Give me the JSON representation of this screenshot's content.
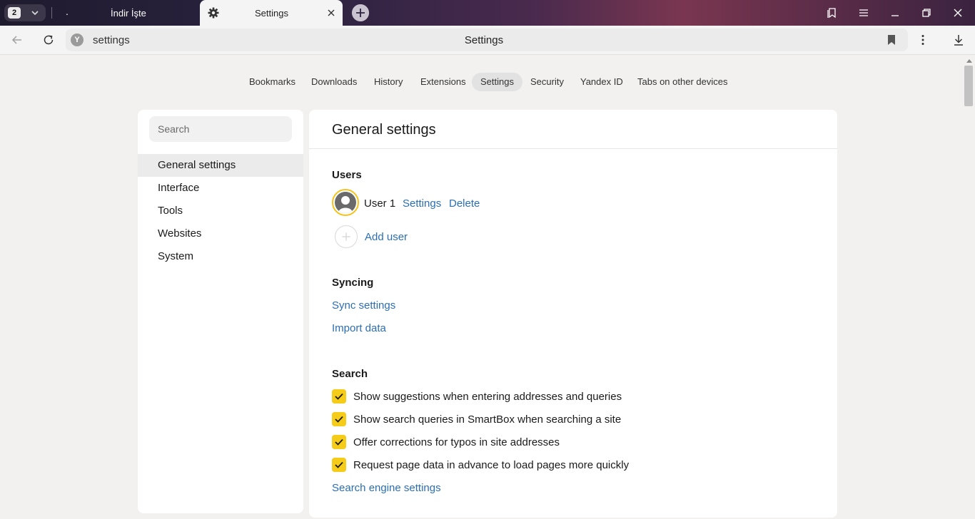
{
  "titlebar": {
    "tab_count": "2",
    "tabs": [
      {
        "label": "İndir İşte",
        "favicon": "."
      },
      {
        "label": "Settings",
        "icon": "gear-icon"
      }
    ]
  },
  "addressbar": {
    "url": "settings",
    "page_title": "Settings"
  },
  "topnav": {
    "items": [
      "Bookmarks",
      "Downloads",
      "History",
      "Extensions",
      "Settings",
      "Security",
      "Yandex ID",
      "Tabs on other devices"
    ],
    "active": "Settings"
  },
  "sidebar": {
    "search_placeholder": "Search",
    "items": [
      "General settings",
      "Interface",
      "Tools",
      "Websites",
      "System"
    ],
    "active": "General settings"
  },
  "main": {
    "title": "General settings",
    "users": {
      "heading": "Users",
      "user_name": "User 1",
      "settings_link": "Settings",
      "delete_link": "Delete",
      "add_user": "Add user"
    },
    "syncing": {
      "heading": "Syncing",
      "sync_settings": "Sync settings",
      "import_data": "Import data"
    },
    "search": {
      "heading": "Search",
      "options": [
        {
          "label": "Show suggestions when entering addresses and queries",
          "checked": true
        },
        {
          "label": "Show search queries in SmartBox when searching a site",
          "checked": true
        },
        {
          "label": "Offer corrections for typos in site addresses",
          "checked": true
        },
        {
          "label": "Request page data in advance to load pages more quickly",
          "checked": true
        }
      ],
      "engine_settings": "Search engine settings"
    }
  },
  "colors": {
    "accent_checkbox": "#f6cc1b",
    "link": "#2a6fb5",
    "avatar_ring": "#f3c21b"
  }
}
